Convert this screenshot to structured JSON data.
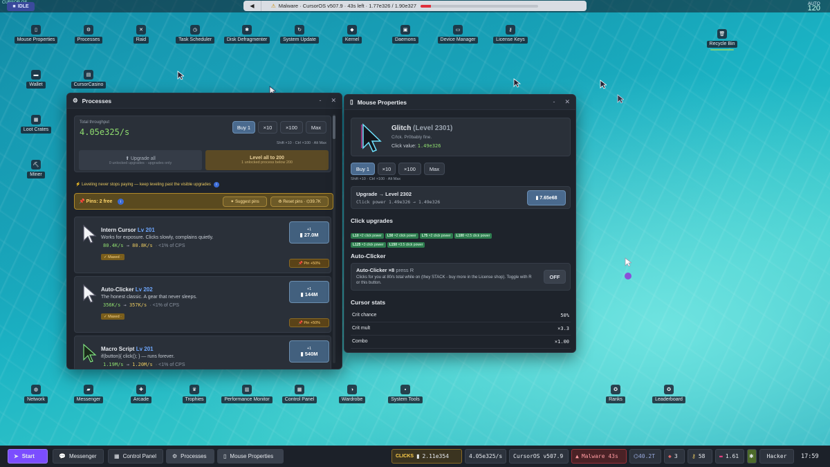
{
  "topbar": {
    "logo_text": "CURSOR OS",
    "idle": "IDLE",
    "back": "◀",
    "title": "Malware · CursorOS v507.9 · 43s left · 1.77e326 / 1.90e327",
    "malware_progress": 0.09,
    "auto_label": "AUTO",
    "auto_value": "120"
  },
  "desktop": {
    "top_icons": [
      {
        "label": "Mouse Properties",
        "icon": "mouse-icon"
      },
      {
        "label": "Processes",
        "icon": "gear-icon"
      },
      {
        "label": "Raid",
        "icon": "swords-icon"
      },
      {
        "label": "Task Scheduler",
        "icon": "clock-icon"
      },
      {
        "label": "Disk Defragmenter",
        "icon": "puzzle-icon"
      },
      {
        "label": "System Update",
        "icon": "refresh-icon"
      },
      {
        "label": "Kernel",
        "icon": "kernel-icon"
      },
      {
        "label": "Daemons",
        "icon": "lock-icon"
      },
      {
        "label": "Device Manager",
        "icon": "monitor-icon"
      },
      {
        "label": "License Keys",
        "icon": "key-icon"
      }
    ],
    "left_icons": [
      {
        "label": "Wallet",
        "icon": "wallet-icon"
      },
      {
        "label": "CursorCasino",
        "icon": "slot-icon"
      },
      {
        "label": "Loot Crates",
        "icon": "crate-icon"
      },
      {
        "label": "Miner",
        "icon": "pickaxe-icon"
      }
    ],
    "recycle": "Recycle Bin",
    "bottom_icons": [
      {
        "label": "Network",
        "icon": "globe-icon"
      },
      {
        "label": "Messenger",
        "icon": "chat-icon"
      },
      {
        "label": "Arcade",
        "icon": "joystick-icon"
      },
      {
        "label": "Trophies",
        "icon": "trophy-icon"
      },
      {
        "label": "Performance Monitor",
        "icon": "chart-icon"
      },
      {
        "label": "Control Panel",
        "icon": "panel-icon"
      },
      {
        "label": "Wardrobe",
        "icon": "palette-icon"
      },
      {
        "label": "System Tools",
        "icon": "toolbox-icon"
      },
      {
        "label": "Ranks",
        "icon": "medal-icon"
      },
      {
        "label": "Leaderboard",
        "icon": "medal-icon"
      }
    ]
  },
  "processes": {
    "title": "Processes",
    "min": "-",
    "close": "✕",
    "throughput_label": "Total throughput",
    "throughput": "4.05e325/s",
    "buy": [
      "Buy 1",
      "×10",
      "×100",
      "Max"
    ],
    "shortcut": "Shift ×10 · Ctrl ×100 · Alt Max",
    "upgrade_all": "⬆ Upgrade all",
    "upgrade_all_sub": "0 unlocked upgrades · upgrades only",
    "level_all": "Level all to 200",
    "level_all_sub": "1 unlocked process below 200",
    "tip": "⚡ Leveling never stops paying — keep leveling past the visible upgrades",
    "pins_label": "Pins: 2 free",
    "suggest": "Suggest pins",
    "reset": "Reset pins · ⌬39.7K",
    "items": [
      {
        "name": "Intern Cursor",
        "lvl": "Lv 201",
        "desc": "Works for exposure. Clicks slowly, complains quietly.",
        "from": "80.4K/s",
        "to": "80.8K/s",
        "cps": "· <1% of CPS",
        "maxed": "✓ Maxed ·",
        "buy_plus": "+1",
        "buy_cost": "27.0M",
        "pin": "Pin +50%"
      },
      {
        "name": "Auto-Clicker",
        "lvl": "Lv 202",
        "desc": "The honest classic. A gear that never sleeps.",
        "from": "356K/s",
        "to": "357K/s",
        "cps": "· <1% of CPS",
        "maxed": "✓ Maxed ·",
        "buy_plus": "+1",
        "buy_cost": "144M",
        "pin": "Pin +50%"
      },
      {
        "name": "Macro Script",
        "lvl": "Lv 201",
        "desc": "if(button){ click(); } — runs forever.",
        "from": "1.19M/s",
        "to": "1.20M/s",
        "cps": "· <1% of CPS",
        "maxed": "",
        "buy_plus": "+1",
        "buy_cost": "540M",
        "pin": ""
      }
    ]
  },
  "mouse": {
    "title": "Mouse Properties",
    "min": "-",
    "close": "✕",
    "name": "Glitch",
    "level": "(Level 2301)",
    "tagline": "C/!ck. Pr0bably fine.",
    "click_label": "Click value:",
    "click_value": "1.49e326",
    "buy": [
      "Buy 1",
      "×10",
      "×100",
      "Max"
    ],
    "shortcut": "Shift ×10 · Ctrl ×100 · Alt Max",
    "upgrade_title": "Upgrade → Level 2302",
    "upgrade_line": "Click power 1.49e326 → 1.49e326",
    "upgrade_cost": "7.65e68",
    "click_upgrades_title": "Click upgrades",
    "chips_row1": [
      {
        "l": "L10",
        "t": "×2 click power"
      },
      {
        "l": "L50",
        "t": "×2 click power"
      },
      {
        "l": "L75",
        "t": "×2 click power"
      },
      {
        "l": "L100",
        "t": "×2.5 click power"
      }
    ],
    "chips_row2": [
      {
        "l": "L125",
        "t": "×3 click power"
      },
      {
        "l": "L150",
        "t": "×3.5 click power"
      }
    ],
    "autoclicker_title": "Auto-Clicker",
    "ac_name": "Auto-Clicker ×8",
    "ac_hint": "press R",
    "ac_desc": "Clicks for you at 80/s total while on (they STACK - buy more in the License shop). Toggle with R or this button.",
    "ac_toggle": "OFF",
    "stats_title": "Cursor stats",
    "stats": [
      {
        "k": "Crit chance",
        "v": "50%"
      },
      {
        "k": "Crit mult",
        "v": "×3.3"
      },
      {
        "k": "Combo",
        "v": "×1.00"
      }
    ]
  },
  "taskbar": {
    "start": "Start",
    "tasks": [
      "Messenger",
      "Control Panel",
      "Processes",
      "Mouse Properties"
    ],
    "clicks_label": "CLICKS",
    "clicks": "2.11e354",
    "rate": "4.05e325/s",
    "version": "CursorOS v507.9",
    "malware": "Malware 43s",
    "coins": "⌬40.2T",
    "gems": "3",
    "keys": "58",
    "mult": "1.61",
    "rank": "Hacker",
    "time": "17:59"
  },
  "colors": {
    "accent": "#7b4dff",
    "malware": "#e0303c",
    "green": "#8fdd6f",
    "gold": "#e8c860"
  }
}
